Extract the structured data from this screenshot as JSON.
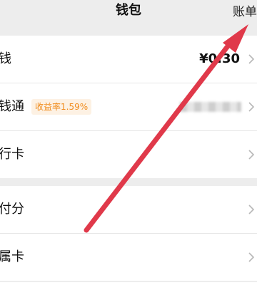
{
  "topbar": {
    "title": "钱包",
    "right_link": "账单"
  },
  "rows": [
    {
      "label": "钱",
      "value": "¥0.30"
    },
    {
      "label": "钱通",
      "badge": "收益率1.59%"
    },
    {
      "label": "行卡"
    },
    {
      "label": "付分"
    },
    {
      "label": "属卡"
    }
  ],
  "colors": {
    "accent_badge_text": "#f08c1e",
    "annotation_arrow": "#e0394a"
  }
}
